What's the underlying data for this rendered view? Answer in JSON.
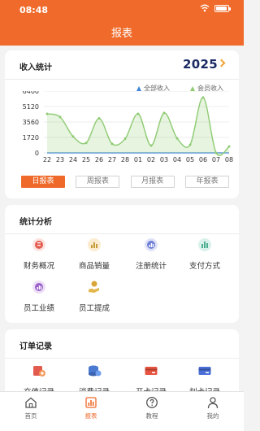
{
  "status": {
    "time": "08:48"
  },
  "header": {
    "title": "报表"
  },
  "income": {
    "title": "收入统计",
    "year": "2025",
    "legend": [
      "全部收入",
      "会员收入"
    ],
    "periods": [
      "日报表",
      "周报表",
      "月报表",
      "年报表"
    ],
    "active_period": 0
  },
  "chart_data": {
    "type": "line",
    "x": [
      "22",
      "23",
      "24",
      "25",
      "26",
      "27",
      "28",
      "01",
      "02",
      "03",
      "04",
      "05",
      "06",
      "07",
      "08"
    ],
    "series": [
      {
        "name": "全部收入",
        "values": [
          0,
          0,
          0,
          0,
          0,
          0,
          0,
          0,
          0,
          0,
          0,
          0,
          0,
          0,
          0
        ]
      },
      {
        "name": "会员收入",
        "values": [
          4300,
          3950,
          1800,
          1100,
          3800,
          1000,
          1550,
          4300,
          800,
          4400,
          1600,
          900,
          6100,
          0,
          700
        ]
      }
    ],
    "yticks": [
      0,
      1700,
      3400,
      5100,
      6800
    ],
    "ytick_labels": [
      "0",
      "1720",
      "3560",
      "5120",
      "6400"
    ],
    "ylim": [
      0,
      6800
    ],
    "grid": true,
    "legend_position": "top-right"
  },
  "analysis": {
    "title": "统计分析",
    "items": [
      {
        "label": "财务概况",
        "icon": "finance-overview-icon"
      },
      {
        "label": "商品销量",
        "icon": "product-sales-icon"
      },
      {
        "label": "注册统计",
        "icon": "registration-stats-icon"
      },
      {
        "label": "支付方式",
        "icon": "payment-method-icon"
      },
      {
        "label": "员工业绩",
        "icon": "staff-performance-icon"
      },
      {
        "label": "员工提成",
        "icon": "staff-commission-icon"
      }
    ]
  },
  "orders": {
    "title": "订单记录",
    "items": [
      {
        "label": "充值记录",
        "icon": "recharge-record-icon"
      },
      {
        "label": "消费记录",
        "icon": "consumption-record-icon"
      },
      {
        "label": "开卡记录",
        "icon": "card-open-record-icon"
      },
      {
        "label": "划卡记录",
        "icon": "card-swipe-record-icon"
      }
    ]
  },
  "tabbar": {
    "items": [
      "首页",
      "报表",
      "教程",
      "我的"
    ],
    "active": 1
  },
  "colors": {
    "brand": "#f06b2b",
    "series_blue": "#3f84d8",
    "series_green": "#8ecb72"
  }
}
